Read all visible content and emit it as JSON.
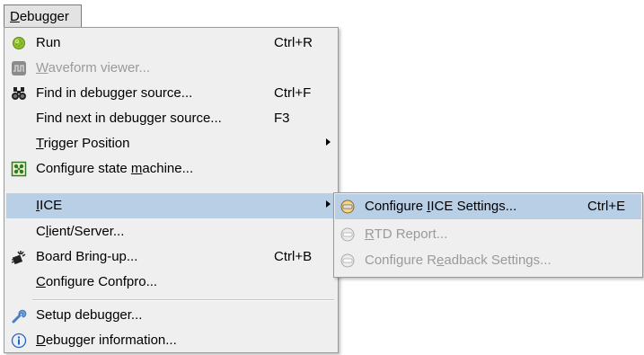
{
  "menubar": {
    "debugger": {
      "pre": "",
      "mn": "D",
      "post": "ebugger"
    }
  },
  "menu": {
    "run": {
      "pre": "Run",
      "mn": "",
      "post": "",
      "accel": "Ctrl+R"
    },
    "waveform": {
      "pre": "",
      "mn": "W",
      "post": "aveform viewer...",
      "accel": ""
    },
    "find": {
      "pre": "Find in debugger source...",
      "mn": "",
      "post": "",
      "accel": "Ctrl+F"
    },
    "find_next": {
      "pre": "Find next in debugger source...",
      "mn": "",
      "post": "",
      "accel": "F3"
    },
    "trigger": {
      "pre": "",
      "mn": "T",
      "post": "rigger Position",
      "accel": ""
    },
    "state_machine": {
      "pre": "Configure state ",
      "mn": "m",
      "post": "achine...",
      "accel": ""
    },
    "iice": {
      "pre": "",
      "mn": "I",
      "post": "ICE",
      "accel": ""
    },
    "client_server": {
      "pre": "C",
      "mn": "l",
      "post": "ient/Server...",
      "accel": ""
    },
    "board": {
      "pre": "Board Bring-up...",
      "mn": "",
      "post": "",
      "accel": "Ctrl+B"
    },
    "confpro": {
      "pre": "",
      "mn": "C",
      "post": "onfigure Confpro...",
      "accel": ""
    },
    "setup": {
      "pre": "Setup debugger...",
      "mn": "",
      "post": "",
      "accel": ""
    },
    "info": {
      "pre": "",
      "mn": "D",
      "post": "ebugger information...",
      "accel": ""
    }
  },
  "submenu": {
    "configure_iice": {
      "pre": "Configure ",
      "mn": "I",
      "post": "ICE Settings...",
      "accel": "Ctrl+E"
    },
    "rtd": {
      "pre": "",
      "mn": "R",
      "post": "TD Report...",
      "accel": ""
    },
    "readback": {
      "pre": "Configure R",
      "mn": "e",
      "post": "adback Settings...",
      "accel": ""
    }
  },
  "background_fragment": "",
  "colors": {
    "menu_bg": "#efefef",
    "highlight": "#b9cfe6",
    "disabled_text": "#9a9a9a"
  }
}
